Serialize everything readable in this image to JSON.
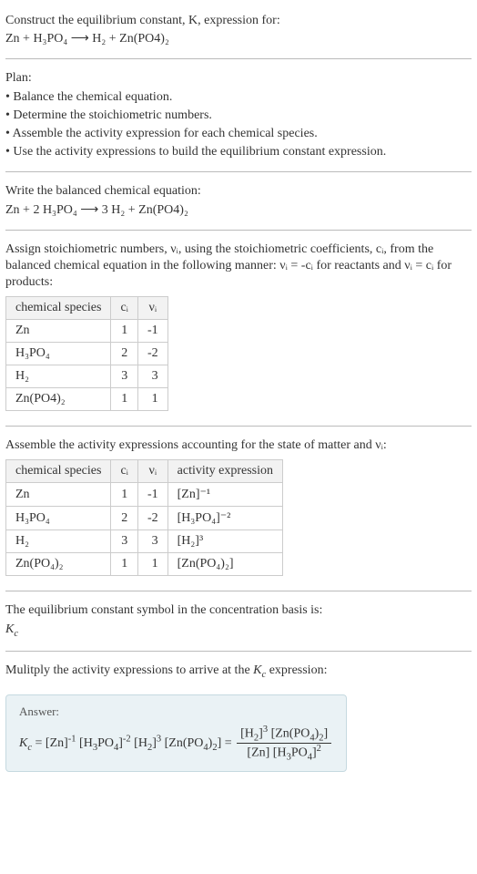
{
  "intro": {
    "line1": "Construct the equilibrium constant, K, expression for:",
    "equation": "Zn + H₃PO₄  ⟶  H₂ + Zn(PO4)₂"
  },
  "plan": {
    "heading": "Plan:",
    "items": [
      "• Balance the chemical equation.",
      "• Determine the stoichiometric numbers.",
      "• Assemble the activity expression for each chemical species.",
      "• Use the activity expressions to build the equilibrium constant expression."
    ]
  },
  "balanced": {
    "heading": "Write the balanced chemical equation:",
    "equation": "Zn + 2 H₃PO₄  ⟶  3 H₂ + Zn(PO4)₂"
  },
  "assign": {
    "text": "Assign stoichiometric numbers, νᵢ, using the stoichiometric coefficients, cᵢ, from the balanced chemical equation in the following manner: νᵢ = -cᵢ for reactants and νᵢ = cᵢ for products:",
    "headers": [
      "chemical species",
      "cᵢ",
      "νᵢ"
    ],
    "rows": [
      {
        "species": "Zn",
        "c": "1",
        "v": "-1"
      },
      {
        "species": "H₃PO₄",
        "c": "2",
        "v": "-2"
      },
      {
        "species": "H₂",
        "c": "3",
        "v": "3"
      },
      {
        "species": "Zn(PO4)₂",
        "c": "1",
        "v": "1"
      }
    ]
  },
  "assemble": {
    "text": "Assemble the activity expressions accounting for the state of matter and νᵢ:",
    "headers": [
      "chemical species",
      "cᵢ",
      "νᵢ",
      "activity expression"
    ],
    "rows": [
      {
        "species": "Zn",
        "c": "1",
        "v": "-1",
        "act": "[Zn]⁻¹"
      },
      {
        "species": "H₃PO₄",
        "c": "2",
        "v": "-2",
        "act": "[H₃PO₄]⁻²"
      },
      {
        "species": "H₂",
        "c": "3",
        "v": "3",
        "act": "[H₂]³"
      },
      {
        "species": "Zn(PO₄)₂",
        "c": "1",
        "v": "1",
        "act": "[Zn(PO₄)₂]"
      }
    ]
  },
  "symbol": {
    "text": "The equilibrium constant symbol in the concentration basis is:",
    "value": "K_c"
  },
  "multiply": {
    "text": "Mulitply the activity expressions to arrive at the K_c expression:"
  },
  "answer": {
    "label": "Answer:",
    "lhs": "K_c = [Zn]⁻¹ [H₃PO₄]⁻² [H₂]³ [Zn(PO₄)₂] =",
    "frac_num": "[H₂]³ [Zn(PO₄)₂]",
    "frac_den": "[Zn] [H₃PO₄]²"
  }
}
